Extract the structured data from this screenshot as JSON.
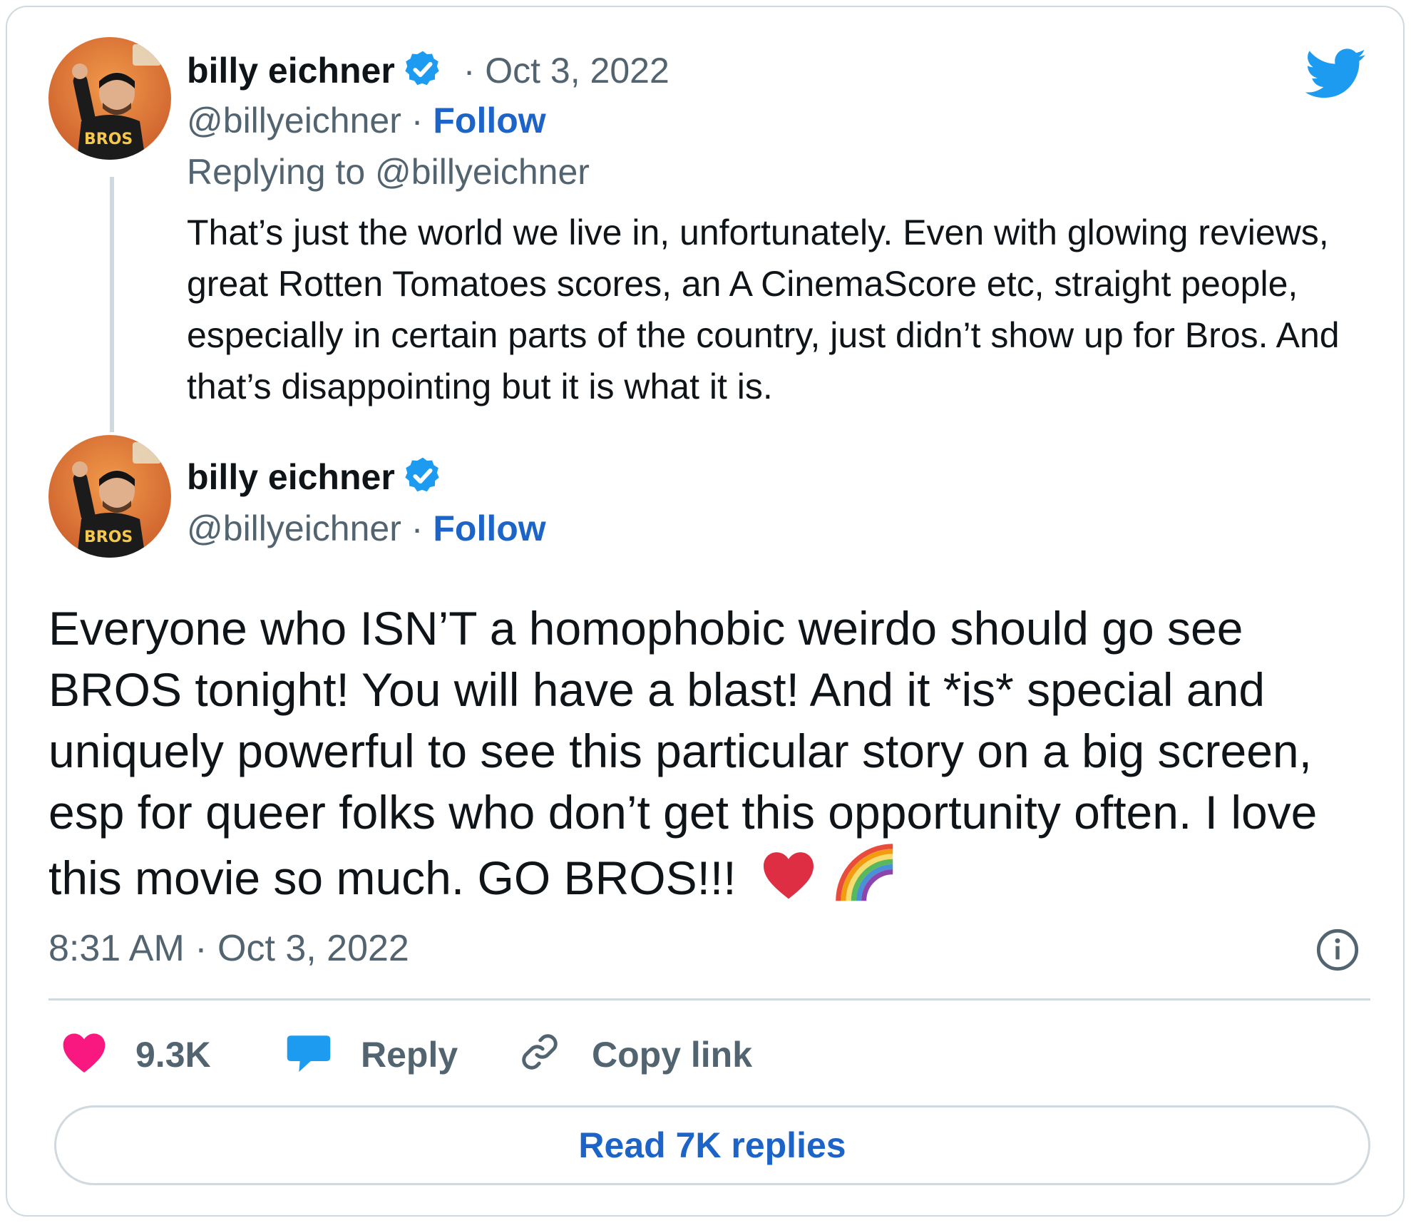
{
  "reply_tweet": {
    "author_name": "billy eichner",
    "date": "Oct 3, 2022",
    "date_separator": "·",
    "handle": "@billyeichner",
    "follow_label": "Follow",
    "replying_to_prefix": "Replying to ",
    "replying_to_handle": "@billyeichner",
    "text": "That’s just the world we live in, unfortunately. Even with glowing reviews, great Rotten Tomatoes scores, an A CinemaScore etc, straight people, especially in certain parts of the country, just didn’t show up for Bros. And that’s disappointing but it is what it is."
  },
  "main_tweet": {
    "author_name": "billy eichner",
    "handle": "@billyeichner",
    "follow_label": "Follow",
    "text": "Everyone who ISN’T a homophobic weirdo should go see BROS tonight! You will have a blast! And it *is* special and uniquely powerful to see this particular story on a big screen, esp for queer folks who don’t get this opportunity often. I love this movie so much. GO BROS!!!",
    "emoji": [
      "red-heart",
      "rainbow"
    ],
    "timestamp": "8:31 AM · Oct 3, 2022"
  },
  "actions": {
    "likes_count": "9.3K",
    "reply_label": "Reply",
    "copy_link_label": "Copy link"
  },
  "read_replies_label": "Read 7K replies",
  "avatar_shirt_text": "BROS",
  "icons": [
    "twitter-bird-icon",
    "verified-badge-icon",
    "info-icon",
    "heart-icon",
    "reply-bubble-icon",
    "link-icon"
  ],
  "colors": {
    "twitter_blue": "#1d9bf0",
    "follow_blue": "#1d64c9",
    "heart_pink": "#f91880",
    "secondary_text": "#536471",
    "border": "#cfd9de"
  }
}
